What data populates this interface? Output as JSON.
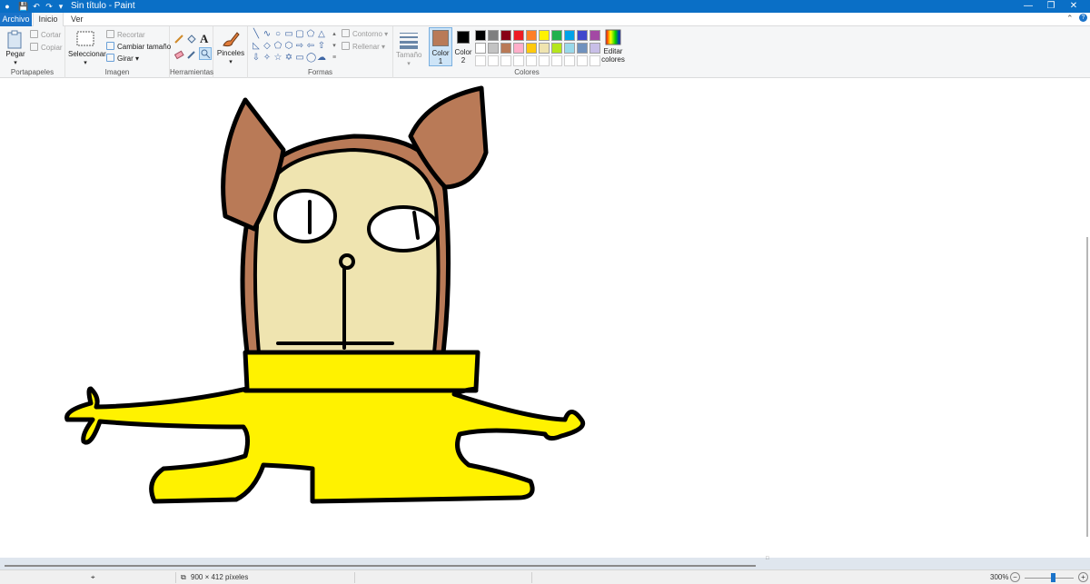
{
  "window": {
    "title": "Sin título - Paint",
    "minimize_icon": "—",
    "maximize_icon": "❐",
    "close_icon": "✕"
  },
  "quick_access": {
    "save": "💾",
    "undo": "↶",
    "redo": "↷",
    "customize": "▾"
  },
  "tabs": {
    "file": "Archivo",
    "home": "Inicio",
    "view": "Ver"
  },
  "ribbon": {
    "clipboard": {
      "paste": "Pegar",
      "cut": "Cortar",
      "copy": "Copiar",
      "label": "Portapapeles"
    },
    "image": {
      "select": "Seleccionar",
      "crop": "Recortar",
      "resize": "Cambiar tamaño",
      "rotate": "Girar",
      "label": "Imagen"
    },
    "tools": {
      "label": "Herramientas",
      "text_tool": "A"
    },
    "brushes": {
      "label": "Pinceles"
    },
    "shapes": {
      "outline": "Contorno",
      "fill": "Rellenar",
      "label": "Formas"
    },
    "size": {
      "label": "Tamaño"
    },
    "colors": {
      "color1_label": "Color",
      "color1_num": "1",
      "color2_label": "Color",
      "color2_num": "2",
      "edit": "Editar colores",
      "label": "Colores",
      "color1": "#b97a57",
      "color2": "#000000",
      "palette_row1": [
        "#000000",
        "#7f7f7f",
        "#880015",
        "#ed1c24",
        "#ff7f27",
        "#fff200",
        "#22b14c",
        "#00a2e8",
        "#3f48cc",
        "#a349a4"
      ],
      "palette_row2": [
        "#ffffff",
        "#c3c3c3",
        "#b97a57",
        "#ffaec9",
        "#ffc90e",
        "#efe4b0",
        "#b5e61d",
        "#99d9ea",
        "#7092be",
        "#c8bfe7"
      ]
    }
  },
  "drawing": {
    "colors": {
      "outline": "#000000",
      "fur": "#b97a57",
      "face": "#efe4b0",
      "body": "#fff200"
    }
  },
  "status": {
    "dimensions": "900 × 412 píxeles",
    "zoom": "300%",
    "zoom_out": "−",
    "zoom_in": "+"
  }
}
